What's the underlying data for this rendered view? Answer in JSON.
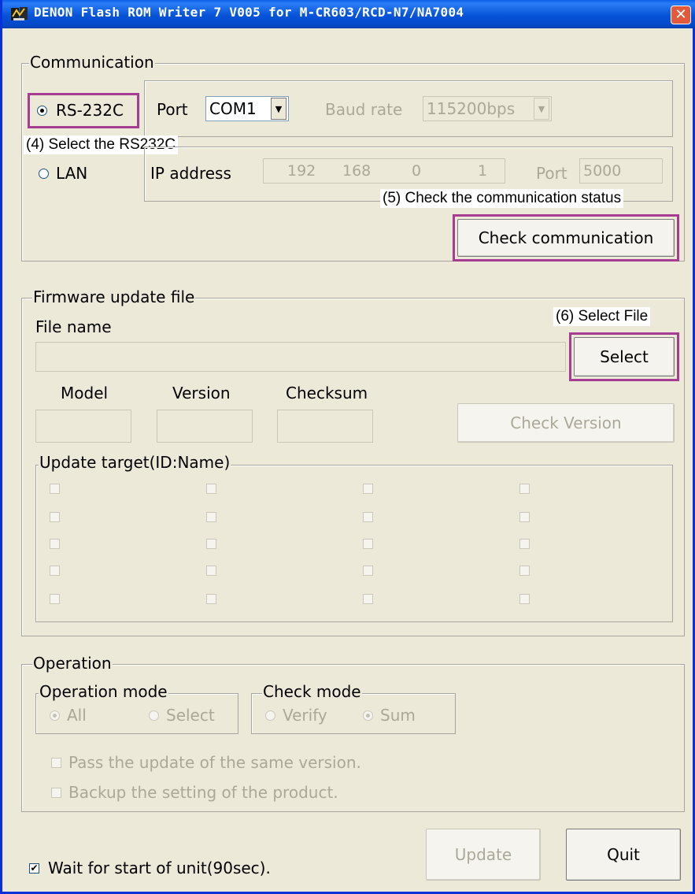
{
  "window": {
    "title": "DENON Flash ROM Writer 7 V005 for M-CR603/RCD-N7/NA7004",
    "close_glyph": "✕"
  },
  "communication": {
    "group_label": "Communication",
    "rs232c_label": "RS-232C",
    "port_label": "Port",
    "port_value": "COM1",
    "baud_label": "Baud rate",
    "baud_value": "115200bps",
    "lan_label": "LAN",
    "ip_label": "IP address",
    "ip_octets": [
      "192",
      "168",
      "0",
      "1"
    ],
    "lan_port_label": "Port",
    "lan_port_value": "5000",
    "check_button": "Check communication"
  },
  "annotations": {
    "step4": "(4) Select the RS232C",
    "step5": "(5) Check the communication status",
    "step6": "(6) Select File",
    "highlight_color": "#a63d93"
  },
  "firmware": {
    "group_label": "Firmware update file",
    "file_name_label": "File name",
    "file_name_value": "",
    "select_button": "Select",
    "model_label": "Model",
    "version_label": "Version",
    "checksum_label": "Checksum",
    "check_version_button": "Check Version",
    "update_target_label": "Update target(ID:Name)"
  },
  "operation": {
    "group_label": "Operation",
    "mode_label": "Operation mode",
    "mode_all": "All",
    "mode_select": "Select",
    "check_label": "Check mode",
    "check_verify": "Verify",
    "check_sum": "Sum",
    "pass_same_version": "Pass the update of the same version.",
    "backup_setting": "Backup the setting of the product."
  },
  "footer": {
    "wait_label": "Wait for start of unit(90sec).",
    "update_button": "Update",
    "quit_button": "Quit"
  },
  "icons": {
    "dropdown": "▼",
    "check": "✔"
  }
}
